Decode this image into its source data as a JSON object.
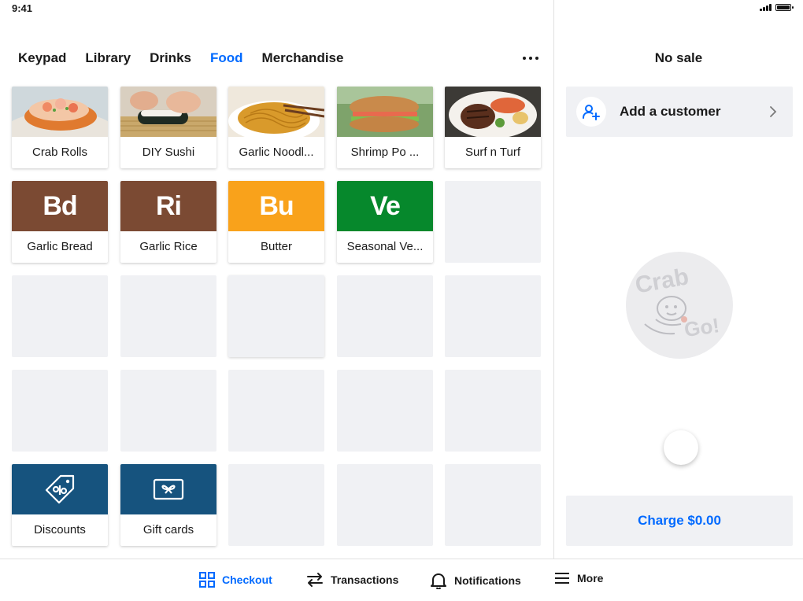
{
  "status_bar": {
    "time": "9:41"
  },
  "tabs": [
    {
      "label": "Keypad",
      "active": false
    },
    {
      "label": "Library",
      "active": false
    },
    {
      "label": "Drinks",
      "active": false
    },
    {
      "label": "Food",
      "active": true
    },
    {
      "label": "Merchandise",
      "active": false
    }
  ],
  "grid": {
    "photo_items": [
      {
        "label": "Crab Rolls"
      },
      {
        "label": "DIY Sushi"
      },
      {
        "label": "Garlic Noodl..."
      },
      {
        "label": "Shrimp Po ..."
      },
      {
        "label": "Surf n Turf"
      }
    ],
    "tile_items": [
      {
        "abbr": "Bd",
        "label": "Garlic Bread",
        "color": "#7b4a33"
      },
      {
        "abbr": "Ri",
        "label": "Garlic Rice",
        "color": "#7b4a33"
      },
      {
        "abbr": "Bu",
        "label": "Butter",
        "color": "#f9a21b"
      },
      {
        "abbr": "Ve",
        "label": "Seasonal Ve...",
        "color": "#06882c"
      }
    ],
    "action_items": [
      {
        "label": "Discounts",
        "icon": "discount-tag-icon",
        "color": "#16537e"
      },
      {
        "label": "Gift cards",
        "icon": "gift-card-icon",
        "color": "#16537e"
      }
    ]
  },
  "sale": {
    "title": "No sale",
    "add_customer_label": "Add a customer",
    "logo_text_1": "Crab",
    "logo_text_2": "Go!",
    "charge_label": "Charge $0.00"
  },
  "bottom_nav": [
    {
      "label": "Checkout",
      "icon": "grid-icon",
      "active": true
    },
    {
      "label": "Transactions",
      "icon": "arrows-swap-icon",
      "active": false
    },
    {
      "label": "Notifications",
      "icon": "bell-icon",
      "active": false
    },
    {
      "label": "More",
      "icon": "hamburger-menu-icon",
      "active": false
    }
  ],
  "colors": {
    "accent": "#006aff",
    "empty_tile": "#f0f1f4",
    "action_tile": "#16537e"
  }
}
